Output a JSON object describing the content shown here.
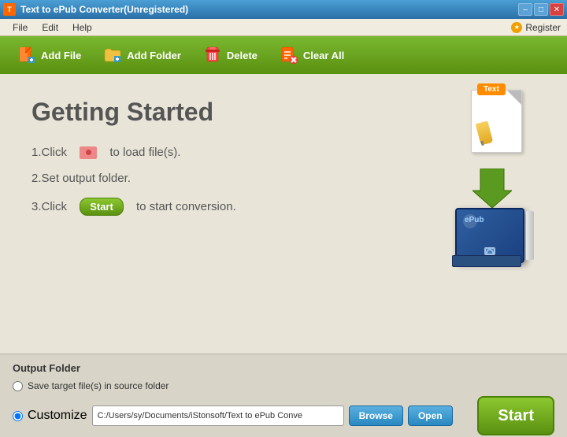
{
  "titleBar": {
    "title": "Text to ePub Converter(Unregistered)",
    "icon": "T",
    "controls": {
      "minimize": "–",
      "maximize": "□",
      "close": "✕"
    }
  },
  "menuBar": {
    "items": [
      {
        "label": "File"
      },
      {
        "label": "Edit"
      },
      {
        "label": "Help"
      }
    ],
    "register": "Register"
  },
  "toolbar": {
    "addFile": "Add File",
    "addFolder": "Add Folder",
    "delete": "Delete",
    "clearAll": "Clear All"
  },
  "gettingStarted": {
    "title": "Getting Started",
    "step1_prefix": "1.Click",
    "step1_suffix": "to load file(s).",
    "step2": "2.Set output folder.",
    "step3_prefix": "3.Click",
    "step3_badge": "Start",
    "step3_suffix": "to start conversion."
  },
  "outputFolder": {
    "title": "Output Folder",
    "saveSourceLabel": "Save target file(s) in source folder",
    "customizeLabel": "Customize",
    "pathValue": "C:/Users/sy/Documents/iStonsoft/Text to ePub Conve",
    "browseLabel": "Browse",
    "openLabel": "Open",
    "startLabel": "Start"
  },
  "colors": {
    "toolbarGreen": "#5a9010",
    "toolbarGreenLight": "#7ab830",
    "btnBlue": "#2888c0",
    "startGreen": "#5a9010"
  }
}
